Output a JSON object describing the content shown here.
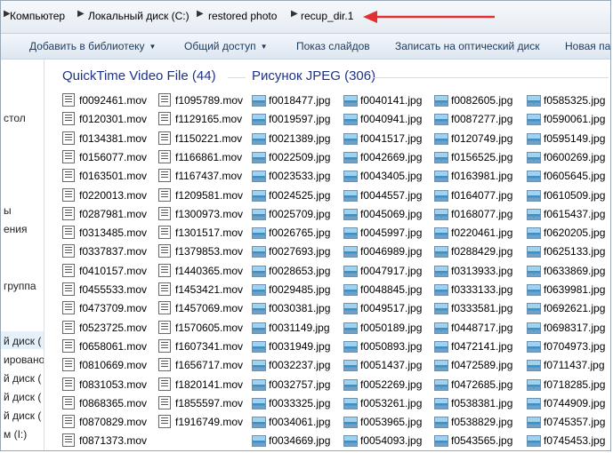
{
  "address": {
    "crumbs": [
      "Компьютер",
      "Локальный диск (C:)",
      "restored photo",
      "recup_dir.1"
    ]
  },
  "toolbar": {
    "add_library": "Добавить в библиотеку",
    "share": "Общий доступ",
    "slideshow": "Показ слайдов",
    "burn": "Записать на оптический диск",
    "new_folder": "Новая па"
  },
  "nav": {
    "items": [
      "стол",
      "ы",
      "ения",
      "группа",
      "й диск (",
      "ировано",
      "й диск (",
      "й диск (",
      "й диск (",
      "м (I:)"
    ]
  },
  "groups": {
    "mov_header": "QuickTime Video File (44)",
    "jpg_header": "Рисунок JPEG (306)"
  },
  "files": {
    "mov_col1": [
      "f0092461.mov",
      "f0120301.mov",
      "f0134381.mov",
      "f0156077.mov",
      "f0163501.mov",
      "f0220013.mov",
      "f0287981.mov",
      "f0313485.mov",
      "f0337837.mov",
      "f0410157.mov",
      "f0455533.mov",
      "f0473709.mov",
      "f0523725.mov",
      "f0658061.mov",
      "f0810669.mov",
      "f0831053.mov",
      "f0868365.mov",
      "f0870829.mov",
      "f0871373.mov"
    ],
    "mov_col2": [
      "f1095789.mov",
      "f1129165.mov",
      "f1150221.mov",
      "f1166861.mov",
      "f1167437.mov",
      "f1209581.mov",
      "f1300973.mov",
      "f1301517.mov",
      "f1379853.mov",
      "f1440365.mov",
      "f1453421.mov",
      "f1457069.mov",
      "f1570605.mov",
      "f1607341.mov",
      "f1656717.mov",
      "f1820141.mov",
      "f1855597.mov",
      "f1916749.mov"
    ],
    "jpg_col1": [
      "f0018477.jpg",
      "f0019597.jpg",
      "f0021389.jpg",
      "f0022509.jpg",
      "f0023533.jpg",
      "f0024525.jpg",
      "f0025709.jpg",
      "f0026765.jpg",
      "f0027693.jpg",
      "f0028653.jpg",
      "f0029485.jpg",
      "f0030381.jpg",
      "f0031149.jpg",
      "f0031949.jpg",
      "f0032237.jpg",
      "f0032757.jpg",
      "f0033325.jpg",
      "f0034061.jpg",
      "f0034669.jpg"
    ],
    "jpg_col2": [
      "f0040141.jpg",
      "f0040941.jpg",
      "f0041517.jpg",
      "f0042669.jpg",
      "f0043405.jpg",
      "f0044557.jpg",
      "f0045069.jpg",
      "f0045997.jpg",
      "f0046989.jpg",
      "f0047917.jpg",
      "f0048845.jpg",
      "f0049517.jpg",
      "f0050189.jpg",
      "f0050893.jpg",
      "f0051437.jpg",
      "f0052269.jpg",
      "f0053261.jpg",
      "f0053965.jpg",
      "f0054093.jpg"
    ],
    "jpg_col3": [
      "f0082605.jpg",
      "f0087277.jpg",
      "f0120749.jpg",
      "f0156525.jpg",
      "f0163981.jpg",
      "f0164077.jpg",
      "f0168077.jpg",
      "f0220461.jpg",
      "f0288429.jpg",
      "f0313933.jpg",
      "f0333133.jpg",
      "f0333581.jpg",
      "f0448717.jpg",
      "f0472141.jpg",
      "f0472589.jpg",
      "f0472685.jpg",
      "f0538381.jpg",
      "f0538829.jpg",
      "f0543565.jpg"
    ],
    "jpg_col4": [
      "f0585325.jpg",
      "f0590061.jpg",
      "f0595149.jpg",
      "f0600269.jpg",
      "f0605645.jpg",
      "f0610509.jpg",
      "f0615437.jpg",
      "f0620205.jpg",
      "f0625133.jpg",
      "f0633869.jpg",
      "f0639981.jpg",
      "f0692621.jpg",
      "f0698317.jpg",
      "f0704973.jpg",
      "f0711437.jpg",
      "f0718285.jpg",
      "f0744909.jpg",
      "f0745357.jpg",
      "f0745453.jpg"
    ]
  },
  "colors": {
    "group_header": "#1e3287",
    "annotation_arrow": "#e03030",
    "toolbar_text": "#1e395b"
  }
}
